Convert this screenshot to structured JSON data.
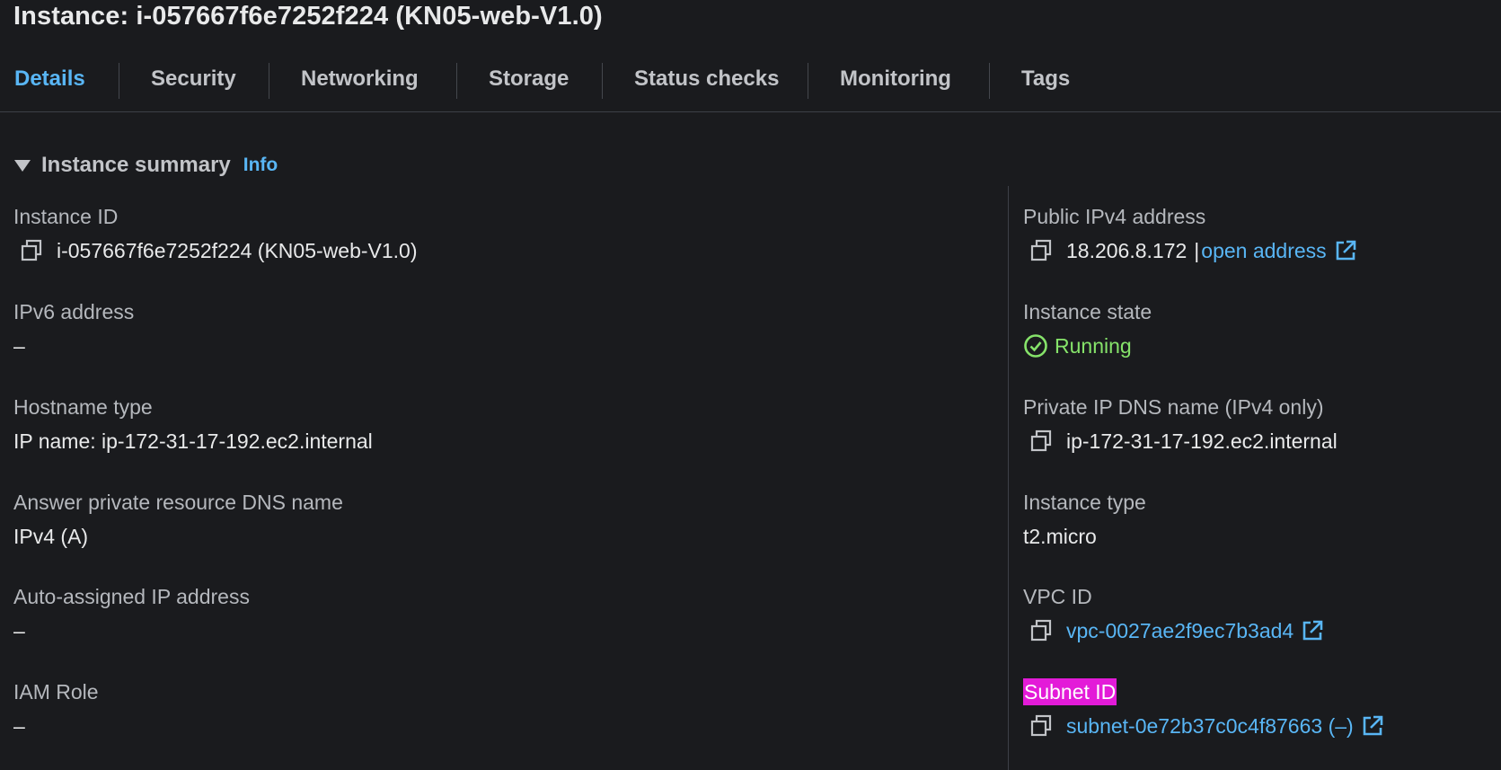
{
  "header": {
    "title": "Instance: i-057667f6e7252f224 (KN05-web-V1.0)"
  },
  "tabs": [
    {
      "label": "Details",
      "active": true
    },
    {
      "label": "Security",
      "active": false
    },
    {
      "label": "Networking",
      "active": false
    },
    {
      "label": "Storage",
      "active": false
    },
    {
      "label": "Status checks",
      "active": false
    },
    {
      "label": "Monitoring",
      "active": false
    },
    {
      "label": "Tags",
      "active": false
    }
  ],
  "section": {
    "title": "Instance summary",
    "info_label": "Info"
  },
  "left": {
    "instance_id": {
      "label": "Instance ID",
      "value": "i-057667f6e7252f224 (KN05-web-V1.0)"
    },
    "ipv6": {
      "label": "IPv6 address",
      "value": "–"
    },
    "hostname_type": {
      "label": "Hostname type",
      "value": "IP name: ip-172-31-17-192.ec2.internal"
    },
    "answer_dns": {
      "label": "Answer private resource DNS name",
      "value": "IPv4 (A)"
    },
    "auto_ip": {
      "label": "Auto-assigned IP address",
      "value": "–"
    },
    "iam_role": {
      "label": "IAM Role",
      "value": "–"
    }
  },
  "right": {
    "public_ipv4": {
      "label": "Public IPv4 address",
      "value": "18.206.8.172",
      "separator": "|",
      "link": "open address"
    },
    "instance_state": {
      "label": "Instance state",
      "value": "Running"
    },
    "private_dns": {
      "label": "Private IP DNS name (IPv4 only)",
      "value": "ip-172-31-17-192.ec2.internal"
    },
    "instance_type": {
      "label": "Instance type",
      "value": "t2.micro"
    },
    "vpc_id": {
      "label": "VPC ID",
      "value": "vpc-0027ae2f9ec7b3ad4"
    },
    "subnet_id": {
      "label": "Subnet ID",
      "value": "subnet-0e72b37c0c4f87663 (–)"
    }
  },
  "colors": {
    "background": "#1a1b1e",
    "link": "#59b6f5",
    "running": "#86e36a",
    "highlight": "#e31bd8"
  },
  "icons": {
    "copy": "copy-icon",
    "external": "external-link-icon",
    "status_ok": "check-circle-icon",
    "caret": "caret-down-icon"
  }
}
